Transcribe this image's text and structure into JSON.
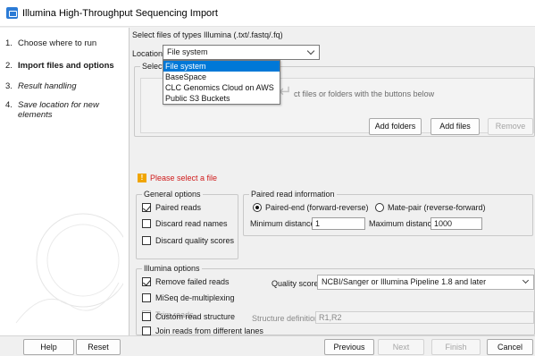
{
  "window": {
    "title": "Illumina High-Throughput Sequencing Import"
  },
  "steps": [
    {
      "num": "1.",
      "label": "Choose where to run"
    },
    {
      "num": "2.",
      "label": "Import files and options"
    },
    {
      "num": "3.",
      "label": "Result handling"
    },
    {
      "num": "4.",
      "label": "Save location for new elements"
    }
  ],
  "import": {
    "files_prompt": "Select files of types Illumina (.txt/.fastq/.fq)",
    "location_label": "Location",
    "location_value": "File system",
    "location_options": [
      "File system",
      "BaseSpace",
      "CLC Genomics Cloud on AWS",
      "Public S3 Buckets"
    ],
    "selected_legend": "Selected",
    "drop_hint": "ct files or folders with the buttons below",
    "add_folders": "Add folders",
    "add_files": "Add files",
    "remove": "Remove",
    "warning": "Please select a file"
  },
  "general": {
    "legend": "General options",
    "paired_reads": "Paired reads",
    "discard_names": "Discard read names",
    "discard_quality": "Discard quality scores"
  },
  "paired": {
    "legend": "Paired read information",
    "paired_end": "Paired-end (forward-reverse)",
    "mate_pair": "Mate-pair (reverse-forward)",
    "min_label": "Minimum distance",
    "min_value": "1",
    "max_label": "Maximum distance",
    "max_value": "1000"
  },
  "illumina": {
    "legend": "Illumina options",
    "remove_failed": "Remove failed reads",
    "quality_label": "Quality scores",
    "quality_value": "NCBI/Sanger or Illumina Pipeline 1.8 and later",
    "miseq": "MiSeq de-multiplexing",
    "trim": "Trim reads",
    "join_lanes": "Join reads from different lanes",
    "custom_structure": "Custom read structure",
    "structure_label": "Structure definition",
    "structure_value": "R1,R2"
  },
  "footer": {
    "help": "Help",
    "reset": "Reset",
    "previous": "Previous",
    "next": "Next",
    "finish": "Finish",
    "cancel": "Cancel"
  },
  "colors": {
    "accent": "#0078d7",
    "warning": "#d01b1b",
    "warning_icon": "#f0a500"
  }
}
